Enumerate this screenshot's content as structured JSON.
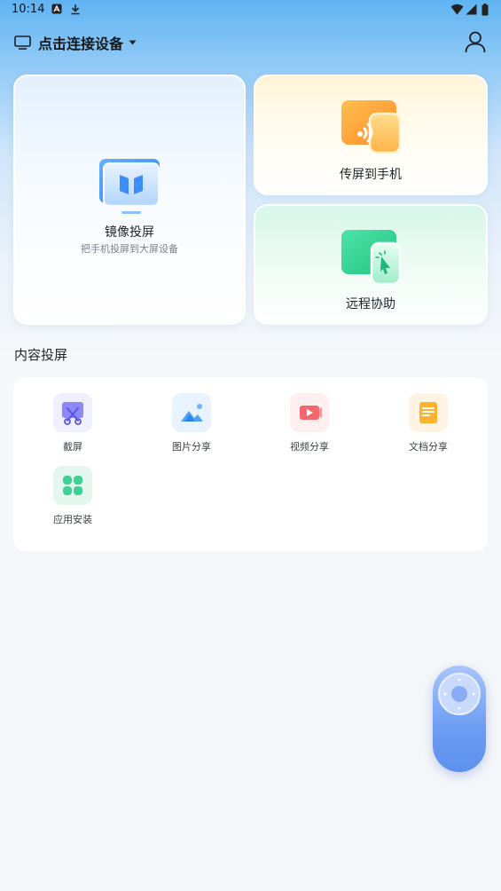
{
  "status_bar": {
    "time": "10:14"
  },
  "header": {
    "device_label": "点击连接设备"
  },
  "cards": {
    "mirror": {
      "title": "镜像投屏",
      "subtitle": "把手机投屏到大屏设备"
    },
    "cast_to_phone": {
      "title": "传屏到手机"
    },
    "remote_assist": {
      "title": "远程协助"
    }
  },
  "content_section": {
    "title": "内容投屏",
    "tools": [
      {
        "label": "截屏",
        "icon": "screenshot-icon"
      },
      {
        "label": "图片分享",
        "icon": "image-share-icon"
      },
      {
        "label": "视频分享",
        "icon": "video-share-icon"
      },
      {
        "label": "文档分享",
        "icon": "document-share-icon"
      },
      {
        "label": "应用安装",
        "icon": "app-install-icon"
      }
    ]
  },
  "colors": {
    "accent_blue": "#5e90ef",
    "header_gradient_top": "#5fb3f2",
    "cast_orange": "#ffa43b",
    "remote_green": "#37d79a",
    "background": "#f5f6f8"
  }
}
